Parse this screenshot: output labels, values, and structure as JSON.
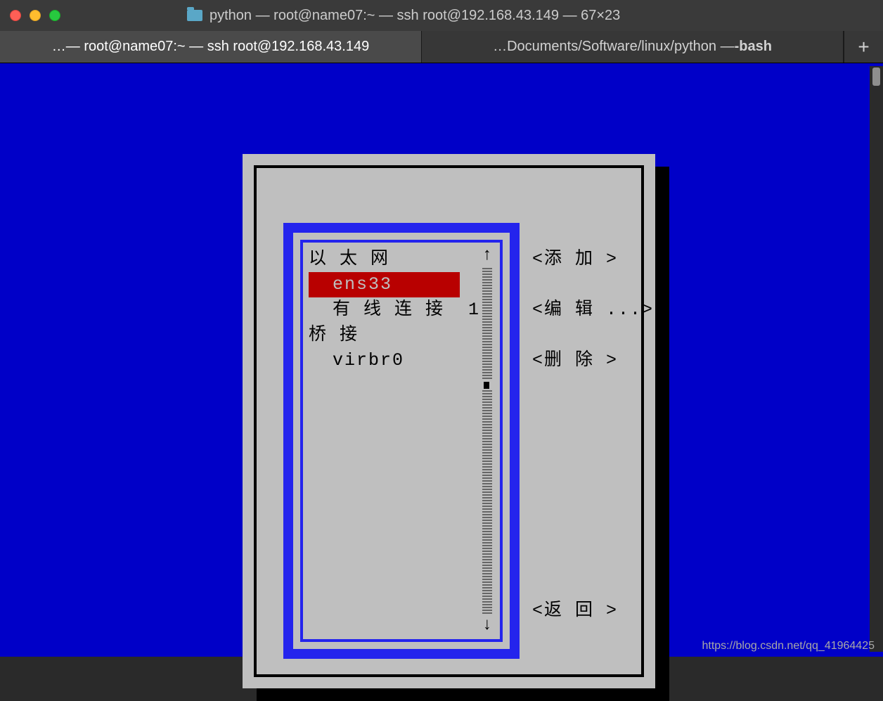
{
  "titlebar": {
    "text": "python — root@name07:~ — ssh root@192.168.43.149 — 67×23"
  },
  "tabs": {
    "active": "…— root@name07:~ — ssh root@192.168.43.149",
    "inactive_prefix": "…Documents/Software/linux/python — ",
    "inactive_bold": "-bash",
    "plus": "+"
  },
  "list": {
    "group1": "以 太 网",
    "item1": "ens33",
    "item2": "有 线 连 接  1",
    "group2": "桥 接",
    "item3": "virbr0",
    "arrow_up": "↑",
    "arrow_down": "↓"
  },
  "actions": {
    "add": "<添 加 >",
    "edit": "<编 辑 ...>",
    "delete": "<删 除 >",
    "back": "<返 回 >"
  },
  "watermark": "https://blog.csdn.net/qq_41964425"
}
